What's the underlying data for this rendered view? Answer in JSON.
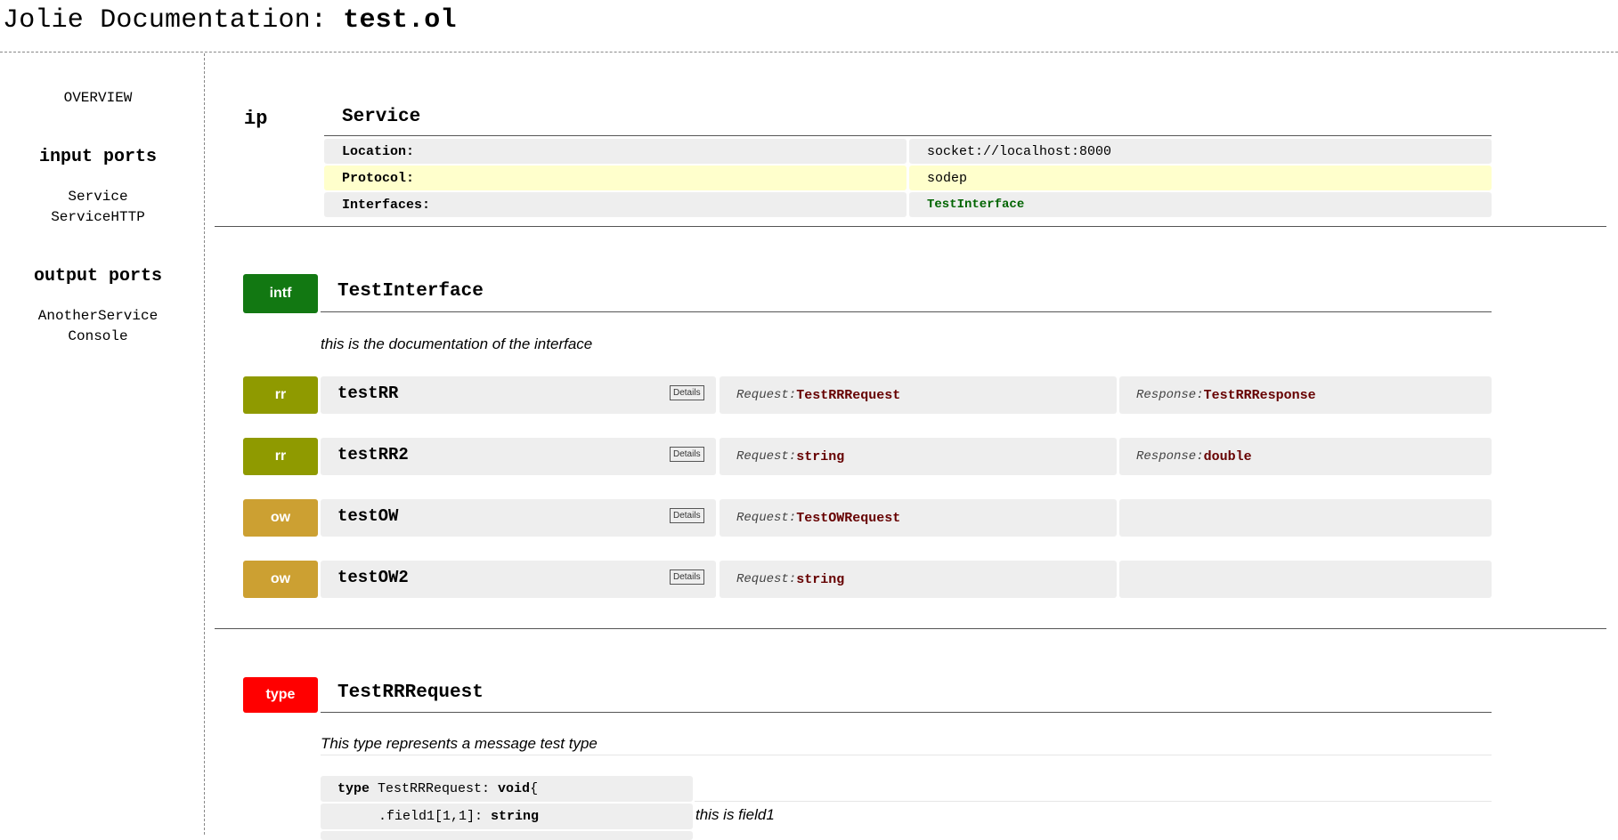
{
  "header": {
    "prefix": "Jolie Documentation: ",
    "file": "test.ol"
  },
  "sidebar": {
    "overview": "OVERVIEW",
    "input_ports_title": "input ports",
    "input_ports": [
      "Service",
      "ServiceHTTP"
    ],
    "output_ports_title": "output ports",
    "output_ports": [
      "AnotherService",
      "Console"
    ]
  },
  "port": {
    "badge": "ip",
    "name": "Service",
    "rows": [
      {
        "label": "Location:",
        "value": "socket://localhost:8000"
      },
      {
        "label": "Protocol:",
        "value": "sodep"
      },
      {
        "label": "Interfaces:",
        "value": "TestInterface"
      }
    ]
  },
  "interface": {
    "badge": "intf",
    "name": "TestInterface",
    "doc": "this is the documentation of the interface",
    "details_label": "Details",
    "request_label": "Request:",
    "response_label": "Response:",
    "operations": [
      {
        "kind": "rr",
        "name": "testRR",
        "request": "TestRRRequest",
        "response": "TestRRResponse"
      },
      {
        "kind": "rr",
        "name": "testRR2",
        "request": "string",
        "response": "double"
      },
      {
        "kind": "ow",
        "name": "testOW",
        "request": "TestOWRequest",
        "response": ""
      },
      {
        "kind": "ow",
        "name": "testOW2",
        "request": "string",
        "response": ""
      }
    ]
  },
  "type_section": {
    "badge": "type",
    "name": "TestRRRequest",
    "doc": "This type represents a message test type",
    "line1_kw": "type",
    "line1_name": " TestRRRequest: ",
    "line1_base": "void",
    "line1_brace": "{",
    "field1": ".field1[1,1]: ",
    "field1_type": "string",
    "field1_doc": "this is field1"
  },
  "colors": {
    "intf": "#127812",
    "rr": "#8f9a00",
    "ow": "#cca032",
    "type": "#ff0000",
    "protocol_row": "#ffffcc"
  }
}
